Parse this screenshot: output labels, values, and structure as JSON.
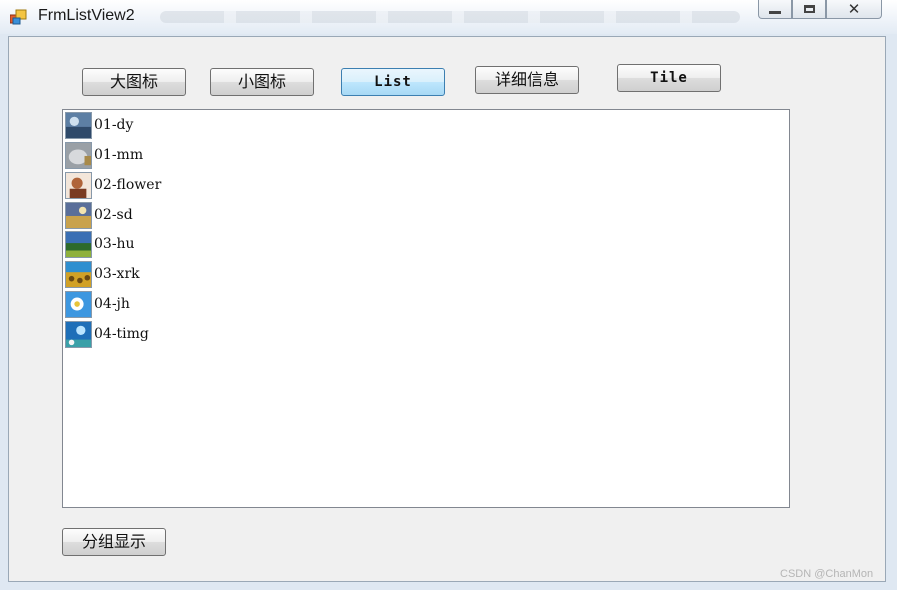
{
  "window": {
    "title": "FrmListView2",
    "close_glyph": "✕",
    "colors": {
      "titlebar": "#eef3f9",
      "client": "#f0f0f0",
      "accent": "#3c7fb1"
    }
  },
  "toolbar": {
    "buttons": [
      {
        "label": "大图标",
        "active": false
      },
      {
        "label": "小图标",
        "active": false
      },
      {
        "label": "List",
        "active": true
      },
      {
        "label": "详细信息",
        "active": false
      },
      {
        "label": "Tile",
        "active": false
      }
    ]
  },
  "listview": {
    "view_mode": "List",
    "items": [
      {
        "label": "01-dy",
        "icon": "image-thumbnail-icon"
      },
      {
        "label": "01-mm",
        "icon": "image-thumbnail-icon"
      },
      {
        "label": "02-flower",
        "icon": "image-thumbnail-icon"
      },
      {
        "label": "02-sd",
        "icon": "image-thumbnail-icon"
      },
      {
        "label": "03-hu",
        "icon": "image-thumbnail-icon"
      },
      {
        "label": "03-xrk",
        "icon": "image-thumbnail-icon"
      },
      {
        "label": "04-jh",
        "icon": "image-thumbnail-icon"
      },
      {
        "label": "04-timg",
        "icon": "image-thumbnail-icon"
      }
    ]
  },
  "group_button": {
    "label": "分组显示"
  },
  "watermark": {
    "text": "CSDN @ChanMon"
  }
}
